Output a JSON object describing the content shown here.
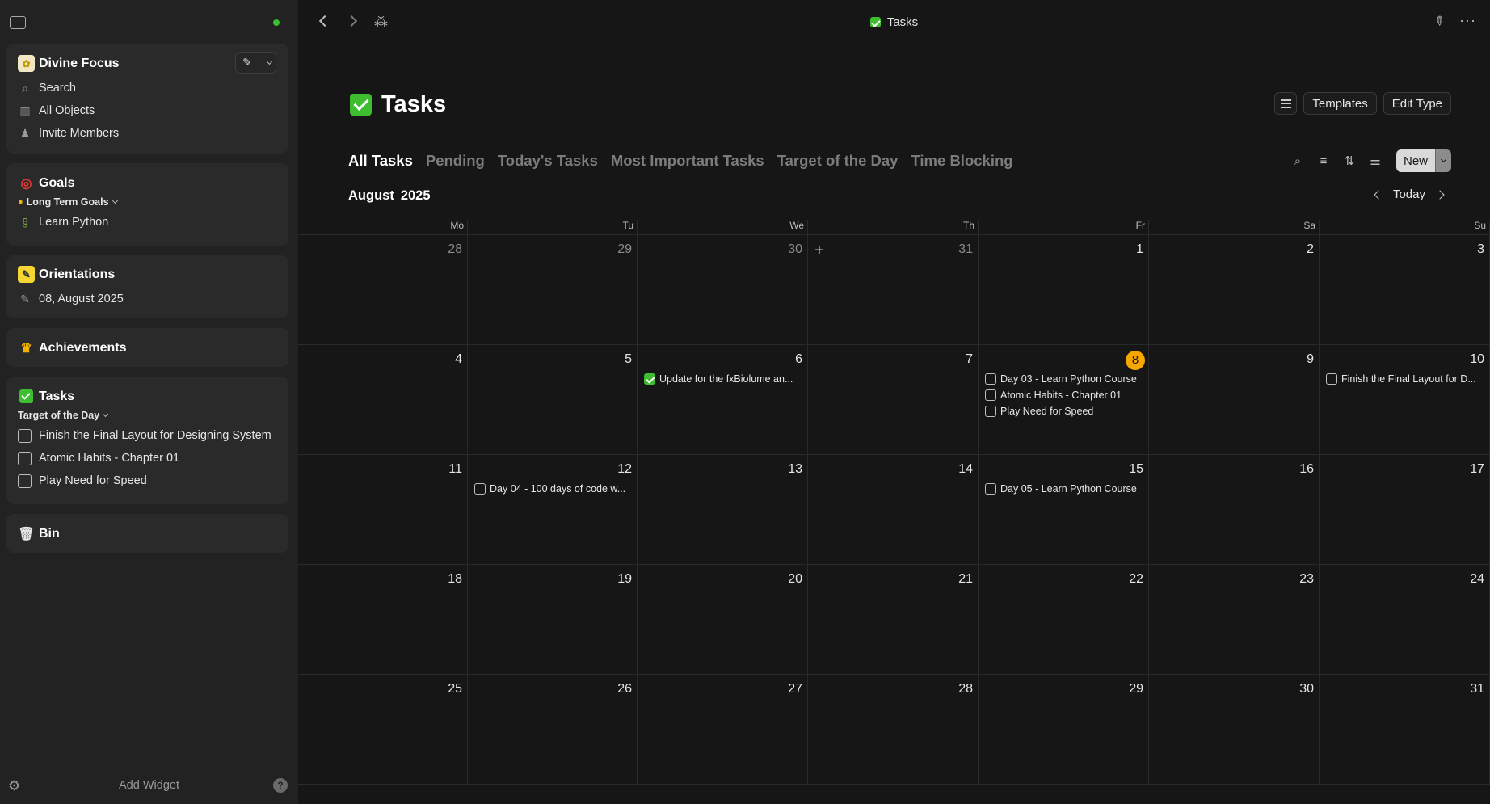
{
  "sidebar": {
    "space": {
      "name": "Divine Focus",
      "items": [
        {
          "label": "Search",
          "icon": "search-icon"
        },
        {
          "label": "All Objects",
          "icon": "book-icon"
        },
        {
          "label": "Invite Members",
          "icon": "members-icon"
        }
      ]
    },
    "goals": {
      "title": "Goals",
      "selector": "Long Term Goals",
      "items": [
        "Learn Python"
      ]
    },
    "orientations": {
      "title": "Orientations",
      "items": [
        "08, August 2025"
      ]
    },
    "achievements": {
      "title": "Achievements"
    },
    "tasks": {
      "title": "Tasks",
      "selector": "Target of the Day",
      "items": [
        "Finish the Final Layout for Designing System",
        "Atomic Habits - Chapter 01",
        "Play Need for Speed"
      ]
    },
    "bin": {
      "title": "Bin"
    },
    "add_widget": "Add Widget",
    "help": "?"
  },
  "topbar": {
    "breadcrumb": "Tasks"
  },
  "page": {
    "title": "Tasks",
    "buttons": {
      "templates": "Templates",
      "edit_type": "Edit Type",
      "new": "New"
    },
    "tabs": [
      {
        "label": "All Tasks",
        "active": true
      },
      {
        "label": "Pending",
        "active": false
      },
      {
        "label": "Today's Tasks",
        "active": false
      },
      {
        "label": "Most Important Tasks",
        "active": false
      },
      {
        "label": "Target of the Day",
        "active": false
      },
      {
        "label": "Time Blocking",
        "active": false
      }
    ]
  },
  "calendar": {
    "month": "August",
    "year": "2025",
    "today_label": "Today",
    "today_day": 8,
    "accent_today": "#f6a600",
    "weekdays": [
      "Mo",
      "Tu",
      "We",
      "Th",
      "Fr",
      "Sa",
      "Su"
    ],
    "weeks": [
      [
        {
          "day": "28",
          "other": true,
          "events": []
        },
        {
          "day": "29",
          "other": true,
          "events": []
        },
        {
          "day": "30",
          "other": true,
          "events": []
        },
        {
          "day": "31",
          "other": true,
          "plus": true,
          "events": []
        },
        {
          "day": "1",
          "events": []
        },
        {
          "day": "2",
          "events": []
        },
        {
          "day": "3",
          "events": []
        }
      ],
      [
        {
          "day": "4",
          "events": []
        },
        {
          "day": "5",
          "events": []
        },
        {
          "day": "6",
          "events": [
            {
              "title": "Update for the fxBiolume an...",
              "done": true
            }
          ]
        },
        {
          "day": "7",
          "events": []
        },
        {
          "day": "8",
          "today": true,
          "events": [
            {
              "title": "Day 03 - Learn Python Course",
              "done": false
            },
            {
              "title": "Atomic Habits - Chapter 01",
              "done": false
            },
            {
              "title": "Play Need for Speed",
              "done": false
            }
          ]
        },
        {
          "day": "9",
          "events": []
        },
        {
          "day": "10",
          "events": [
            {
              "title": "Finish the Final Layout for D...",
              "done": false
            }
          ]
        }
      ],
      [
        {
          "day": "11",
          "events": []
        },
        {
          "day": "12",
          "events": [
            {
              "title": "Day 04 - 100 days of code w...",
              "done": false
            }
          ]
        },
        {
          "day": "13",
          "events": []
        },
        {
          "day": "14",
          "events": []
        },
        {
          "day": "15",
          "events": [
            {
              "title": "Day 05 - Learn Python Course",
              "done": false
            }
          ]
        },
        {
          "day": "16",
          "events": []
        },
        {
          "day": "17",
          "events": []
        }
      ],
      [
        {
          "day": "18",
          "events": []
        },
        {
          "day": "19",
          "events": []
        },
        {
          "day": "20",
          "events": []
        },
        {
          "day": "21",
          "events": []
        },
        {
          "day": "22",
          "events": []
        },
        {
          "day": "23",
          "events": []
        },
        {
          "day": "24",
          "events": []
        }
      ],
      [
        {
          "day": "25",
          "events": []
        },
        {
          "day": "26",
          "events": []
        },
        {
          "day": "27",
          "events": []
        },
        {
          "day": "28",
          "events": []
        },
        {
          "day": "29",
          "events": []
        },
        {
          "day": "30",
          "events": []
        },
        {
          "day": "31",
          "events": []
        }
      ]
    ]
  }
}
